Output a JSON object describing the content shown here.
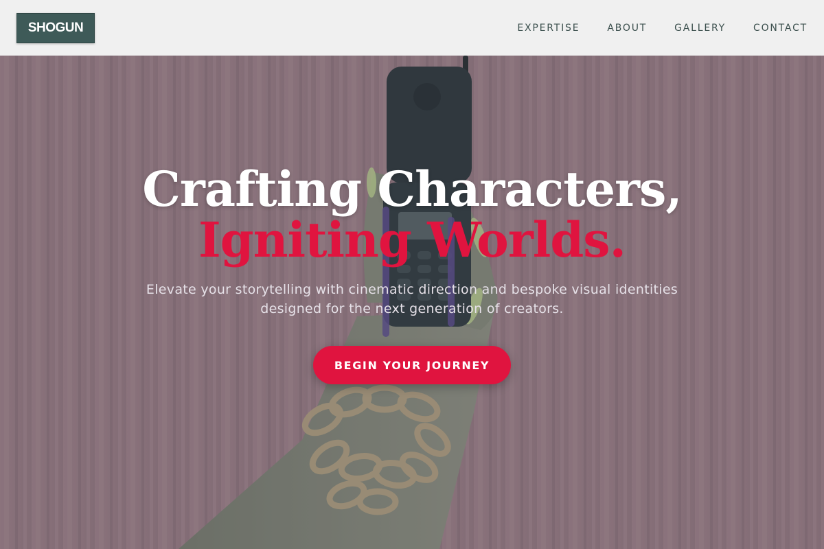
{
  "header": {
    "logo_text": "SHOGUN",
    "nav": [
      {
        "label": "EXPERTISE"
      },
      {
        "label": "ABOUT"
      },
      {
        "label": "GALLERY"
      },
      {
        "label": "CONTACT"
      }
    ]
  },
  "hero": {
    "headline_line1": "Crafting Characters,",
    "headline_line2": "Igniting Worlds.",
    "subtitle": "Elevate your storytelling with cinematic direction and bespoke visual identities designed for the next generation of creators.",
    "cta_label": "BEGIN YOUR JOURNEY",
    "background_image": "hand-holding-flip-phone-with-gold-chain-bracelets-against-pink-curtain"
  },
  "colors": {
    "header_bg": "#f0f0f0",
    "logo_bg": "#3e5a58",
    "nav_text": "#3b4f4d",
    "accent": "#e0143f",
    "headline_white": "#ffffff",
    "subtitle_text": "#e6e1e8"
  }
}
